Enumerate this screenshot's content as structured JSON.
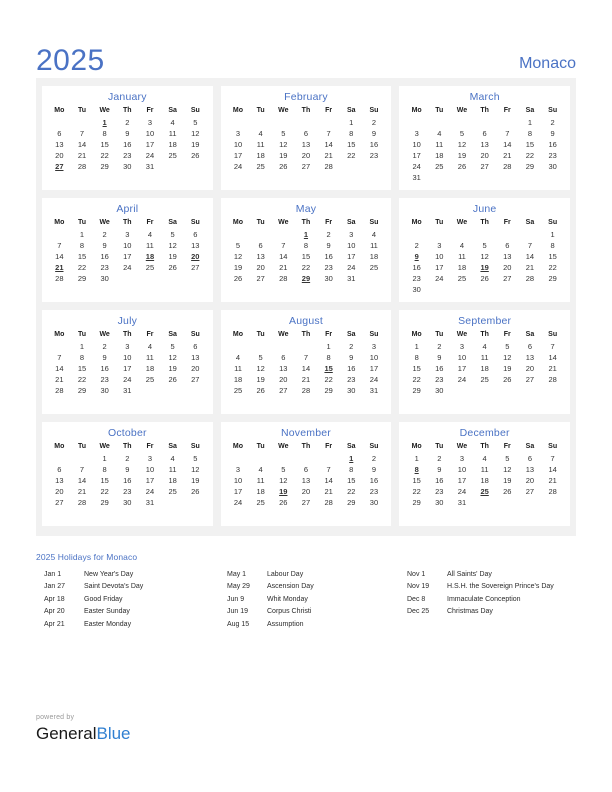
{
  "header": {
    "year": "2025",
    "region": "Monaco",
    "accent_color": "#4a72c4",
    "holiday_color": "#d40000"
  },
  "weekday_headers": [
    "Mo",
    "Tu",
    "We",
    "Th",
    "Fr",
    "Sa",
    "Su"
  ],
  "calendar": {
    "months": [
      {
        "name": "January",
        "lead_blanks": 2,
        "days": 31,
        "holidays": [
          1,
          27
        ]
      },
      {
        "name": "February",
        "lead_blanks": 5,
        "days": 28,
        "holidays": []
      },
      {
        "name": "March",
        "lead_blanks": 5,
        "days": 31,
        "holidays": []
      },
      {
        "name": "April",
        "lead_blanks": 1,
        "days": 30,
        "holidays": [
          18,
          20,
          21
        ]
      },
      {
        "name": "May",
        "lead_blanks": 3,
        "days": 31,
        "holidays": [
          1,
          29
        ]
      },
      {
        "name": "June",
        "lead_blanks": 6,
        "days": 30,
        "holidays": [
          9,
          19
        ]
      },
      {
        "name": "July",
        "lead_blanks": 1,
        "days": 31,
        "holidays": []
      },
      {
        "name": "August",
        "lead_blanks": 4,
        "days": 31,
        "holidays": [
          15
        ]
      },
      {
        "name": "September",
        "lead_blanks": 0,
        "days": 30,
        "holidays": []
      },
      {
        "name": "October",
        "lead_blanks": 2,
        "days": 31,
        "holidays": []
      },
      {
        "name": "November",
        "lead_blanks": 5,
        "days": 30,
        "holidays": [
          1,
          19
        ]
      },
      {
        "name": "December",
        "lead_blanks": 0,
        "days": 31,
        "holidays": [
          8,
          25
        ]
      }
    ]
  },
  "holidays_section": {
    "heading": "2025 Holidays for Monaco",
    "columns": [
      [
        {
          "date": "Jan 1",
          "name": "New Year's Day"
        },
        {
          "date": "Jan 27",
          "name": "Saint Devota's Day"
        },
        {
          "date": "Apr 18",
          "name": "Good Friday"
        },
        {
          "date": "Apr 20",
          "name": "Easter Sunday"
        },
        {
          "date": "Apr 21",
          "name": "Easter Monday"
        }
      ],
      [
        {
          "date": "May 1",
          "name": "Labour Day"
        },
        {
          "date": "May 29",
          "name": "Ascension Day"
        },
        {
          "date": "Jun 9",
          "name": "Whit Monday"
        },
        {
          "date": "Jun 19",
          "name": "Corpus Christi"
        },
        {
          "date": "Aug 15",
          "name": "Assumption"
        }
      ],
      [
        {
          "date": "Nov 1",
          "name": "All Saints' Day"
        },
        {
          "date": "Nov 19",
          "name": "H.S.H. the Sovereign Prince's Day"
        },
        {
          "date": "Dec 8",
          "name": "Immaculate Conception"
        },
        {
          "date": "Dec 25",
          "name": "Christmas Day"
        }
      ]
    ]
  },
  "footer": {
    "powered_by": "powered by",
    "brand_first": "General",
    "brand_second": "Blue"
  }
}
